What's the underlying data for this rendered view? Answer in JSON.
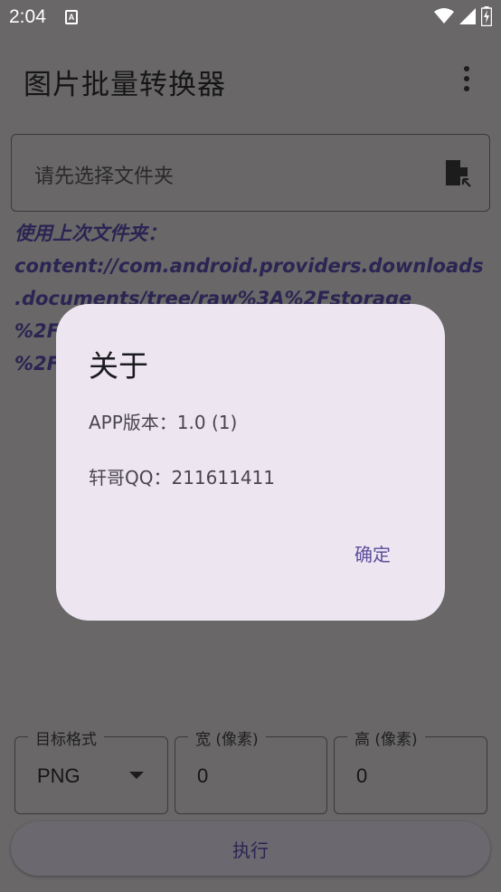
{
  "status": {
    "time": "2:04",
    "notif_icon": "A",
    "icons": [
      "wifi-icon",
      "signal-icon",
      "battery-charging-icon"
    ]
  },
  "appbar": {
    "title": "图片批量转换器",
    "menu_icon": "more-vert-icon"
  },
  "folder": {
    "placeholder": "请先选择文件夹",
    "icon": "file-pick-icon"
  },
  "last_folder": {
    "text": "使用上次文件夹：\ncontent://com.android.providers.downloads\n.documents/tree/raw%3A%2Fstorage\n%2F\n%2F"
  },
  "controls": {
    "format_label": "目标格式",
    "format_value": "PNG",
    "width_label": "宽 (像素)",
    "width_value": "0",
    "height_label": "高 (像素)",
    "height_value": "0",
    "execute_label": "执行"
  },
  "dialog": {
    "title": "关于",
    "version": "APP版本：1.0 (1)",
    "qq": "轩哥QQ：211611411",
    "ok": "确定"
  },
  "colors": {
    "scrim": "#696768",
    "dialog_bg": "#ede6f1",
    "accent": "#5b4d9a",
    "path_text": "#2a2552"
  }
}
